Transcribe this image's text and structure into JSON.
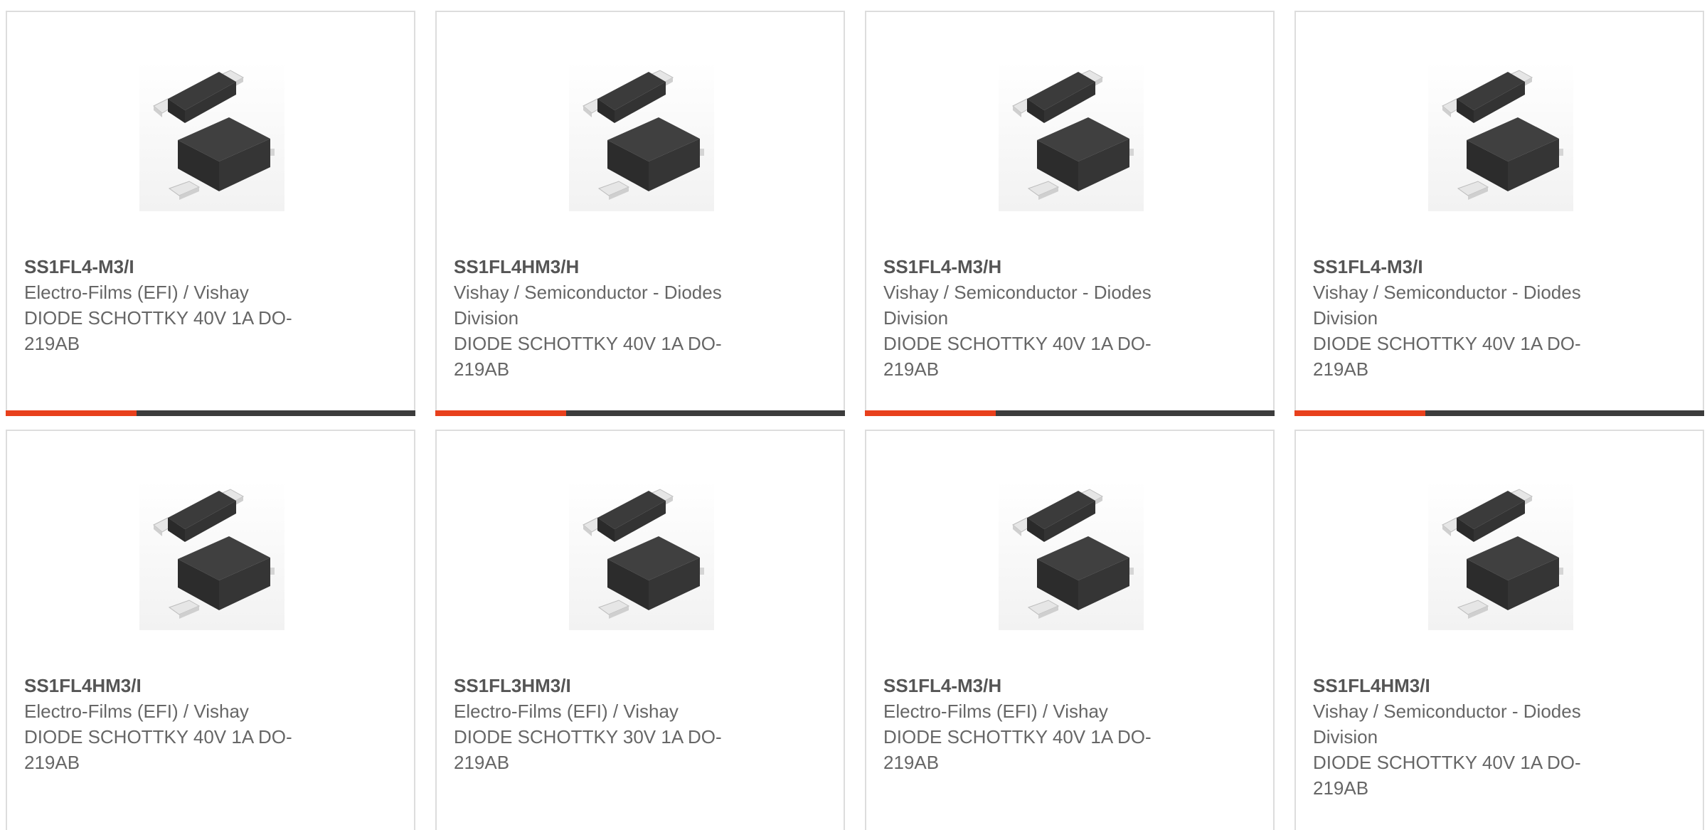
{
  "colors": {
    "accent": "#e8401c",
    "bar": "#3c3c3c",
    "border": "#dddddd",
    "text": "#666666"
  },
  "products": [
    {
      "part_number": "SS1FL4-M3/I",
      "manufacturer": "Electro-Films (EFI) / Vishay",
      "description": "DIODE SCHOTTKY 40V 1A DO-219AB",
      "image_icon": "diode-package-image"
    },
    {
      "part_number": "SS1FL4HM3/H",
      "manufacturer": "Vishay / Semiconductor - Diodes Division",
      "description": "DIODE SCHOTTKY 40V 1A DO-219AB",
      "image_icon": "diode-package-image"
    },
    {
      "part_number": "SS1FL4-M3/H",
      "manufacturer": "Vishay / Semiconductor - Diodes Division",
      "description": "DIODE SCHOTTKY 40V 1A DO-219AB",
      "image_icon": "diode-package-image"
    },
    {
      "part_number": "SS1FL4-M3/I",
      "manufacturer": "Vishay / Semiconductor - Diodes Division",
      "description": "DIODE SCHOTTKY 40V 1A DO-219AB",
      "image_icon": "diode-package-image"
    },
    {
      "part_number": "SS1FL4HM3/I",
      "manufacturer": "Electro-Films (EFI) / Vishay",
      "description": "DIODE SCHOTTKY 40V 1A DO-219AB",
      "image_icon": "diode-package-image"
    },
    {
      "part_number": "SS1FL3HM3/I",
      "manufacturer": "Electro-Films (EFI) / Vishay",
      "description": "DIODE SCHOTTKY 30V 1A DO-219AB",
      "image_icon": "diode-package-image"
    },
    {
      "part_number": "SS1FL4-M3/H",
      "manufacturer": "Electro-Films (EFI) / Vishay",
      "description": "DIODE SCHOTTKY 40V 1A DO-219AB",
      "image_icon": "diode-package-image"
    },
    {
      "part_number": "SS1FL4HM3/I",
      "manufacturer": "Vishay / Semiconductor - Diodes Division",
      "description": "DIODE SCHOTTKY 40V 1A DO-219AB",
      "image_icon": "diode-package-image"
    }
  ]
}
